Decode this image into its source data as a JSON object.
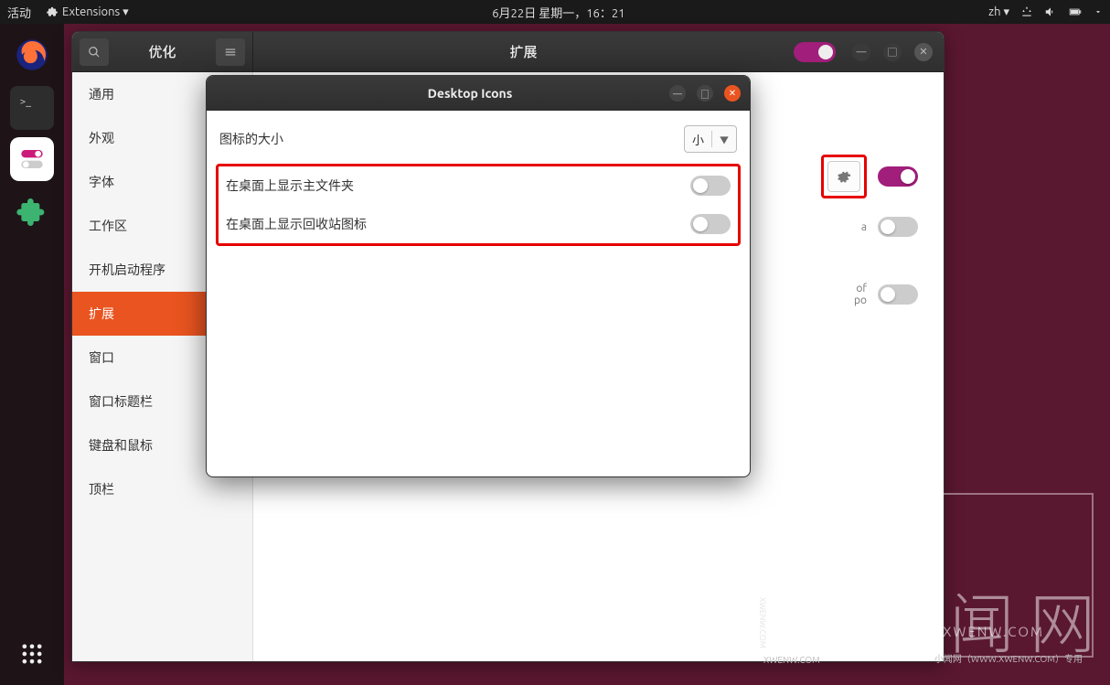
{
  "topbar": {
    "activities": "活动",
    "extensions": "Extensions ▾",
    "datetime": "6月22日 星期一，16：21",
    "input": "zh ▾"
  },
  "tweaks": {
    "title_left": "优化",
    "title_main": "扩展",
    "sidebar": [
      "通用",
      "外观",
      "字体",
      "工作区",
      "开机启动程序",
      "扩展",
      "窗口",
      "窗口标题栏",
      "键盘和鼠标",
      "顶栏"
    ],
    "ext1_desc_a": "a",
    "ext2_desc_1": "of",
    "ext2_desc_2": "po"
  },
  "dialog": {
    "title": "Desktop Icons",
    "icon_size_label": "图标的大小",
    "icon_size_value": "小",
    "row1": "在桌面上显示主文件夹",
    "row2": "在桌面上显示回收站图标"
  },
  "watermark": {
    "main": "小闻网",
    "sub": "XWENW.COM",
    "footer1": "XWENW.COM",
    "footer2": "小闻网（WWW.XWENW.COM）专用",
    "vtext": "XWENW.COM"
  }
}
